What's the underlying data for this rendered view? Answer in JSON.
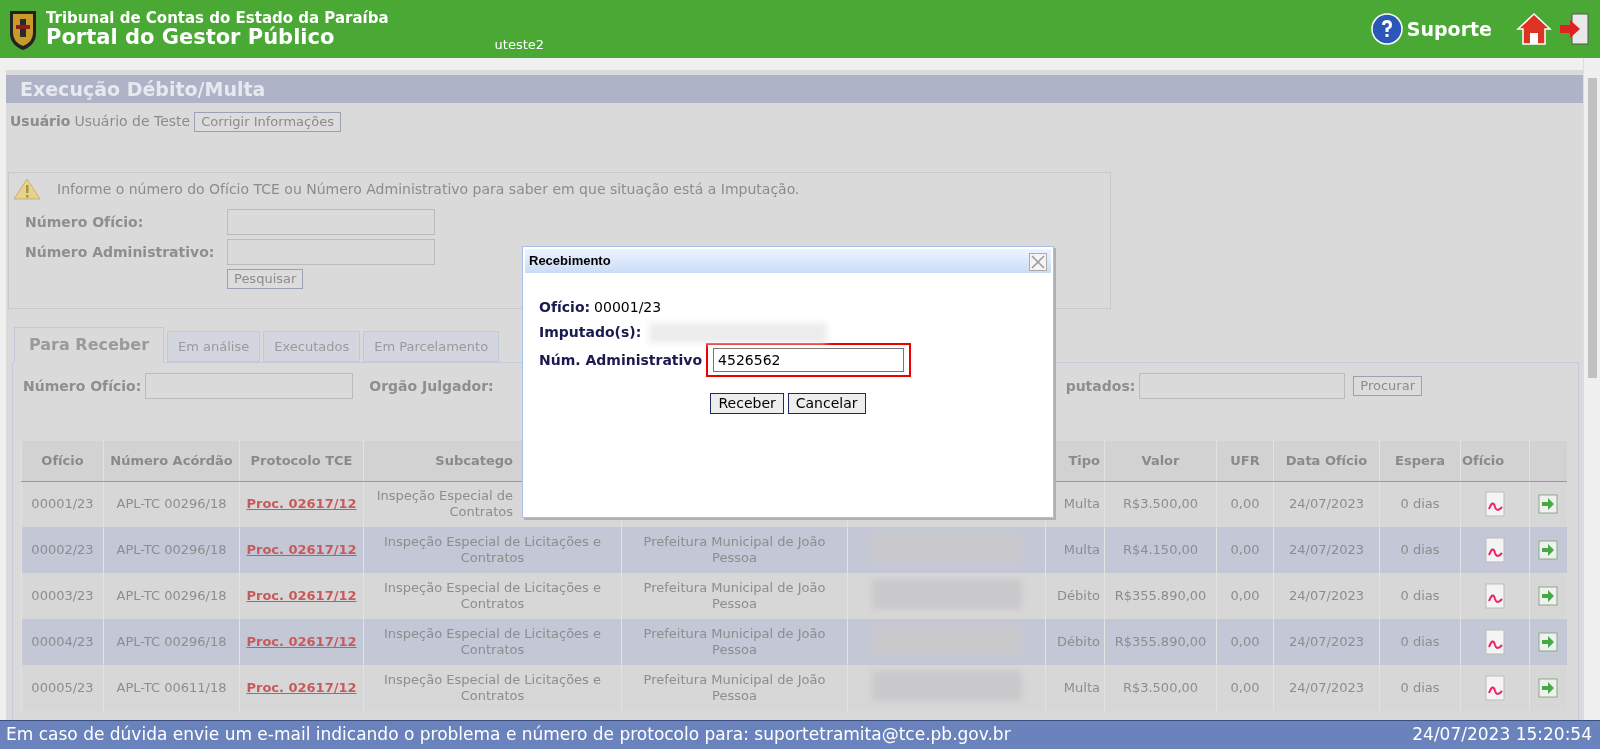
{
  "header": {
    "org": "Tribunal de Contas do Estado da Paraíba",
    "portal": "Portal do Gestor Público",
    "user": "uteste2",
    "support": "Suporte"
  },
  "page": {
    "title": "Execução Débito/Multa",
    "user_label": "Usuário",
    "user_name": "Usuário de Teste",
    "edit_button": "Corrigir Informações"
  },
  "search": {
    "notice": "Informe o número do Ofício TCE ou Número Administrativo para saber em que situação está a Imputação.",
    "fields": [
      {
        "label": "Número Ofício:"
      },
      {
        "label": "Número Administrativo:"
      }
    ],
    "button": "Pesquisar"
  },
  "tabs": [
    {
      "label": "Para Receber",
      "selected": true
    },
    {
      "label": "Em análise",
      "selected": false
    },
    {
      "label": "Executados",
      "selected": false
    },
    {
      "label": "Em Parcelamento",
      "selected": false
    }
  ],
  "filters": {
    "left": [
      {
        "label": "Número Ofício:",
        "kind": "input"
      },
      {
        "label": "Orgão Julgador:",
        "kind": "label"
      }
    ],
    "right": {
      "label": "putados:"
    },
    "button": "Procurar"
  },
  "table": {
    "columns": [
      {
        "label": "Ofício"
      },
      {
        "label": "Número Acórdão"
      },
      {
        "label": "Protocolo TCE"
      },
      {
        "label": "Subcatego"
      },
      {},
      {},
      {
        "label": "Tipo"
      },
      {
        "label": "Valor"
      },
      {
        "label": "UFR"
      },
      {
        "label": "Data Ofício"
      },
      {
        "label": "Espera"
      },
      {
        "label": "Ofício"
      },
      {}
    ],
    "rows": [
      {
        "oficio": "00001/23",
        "acordao": "APL-TC 00296/18",
        "protocolo": "Proc. 02617/12",
        "subcategoria": [
          "Inspeção Especial de",
          "Contratos"
        ],
        "tipo": "Multa",
        "valor": "R$3.500,00",
        "ufr": "0,00",
        "data": "24/07/2023",
        "espera": "0 dias"
      },
      {
        "oficio": "00002/23",
        "acordao": "APL-TC 00296/18",
        "protocolo": "Proc. 02617/12",
        "subcategoria": "Inspeção Especial de Licitações e Contratos",
        "orgao": "Prefeitura Municipal de João Pessoa",
        "tipo": "Multa",
        "valor": "R$4.150,00",
        "ufr": "0,00",
        "data": "24/07/2023",
        "espera": "0 dias"
      },
      {
        "oficio": "00003/23",
        "acordao": "APL-TC 00296/18",
        "protocolo": "Proc. 02617/12",
        "subcategoria": "Inspeção Especial de Licitações e Contratos",
        "orgao": "Prefeitura Municipal de João Pessoa",
        "tipo": "Débito",
        "valor": "R$355.890,00",
        "ufr": "0,00",
        "data": "24/07/2023",
        "espera": "0 dias"
      },
      {
        "oficio": "00004/23",
        "acordao": "APL-TC 00296/18",
        "protocolo": "Proc. 02617/12",
        "subcategoria": "Inspeção Especial de Licitações e Contratos",
        "orgao": "Prefeitura Municipal de João Pessoa",
        "tipo": "Débito",
        "valor": "R$355.890,00",
        "ufr": "0,00",
        "data": "24/07/2023",
        "espera": "0 dias"
      },
      {
        "oficio": "00005/23",
        "acordao": "APL-TC 00611/18",
        "protocolo": "Proc. 02617/12",
        "subcategoria": "Inspeção Especial de Licitações e Contratos",
        "orgao": "Prefeitura Municipal de João Pessoa",
        "tipo": "Multa",
        "valor": "R$3.500,00",
        "ufr": "0,00",
        "data": "24/07/2023",
        "espera": "0 dias"
      }
    ]
  },
  "dialog": {
    "title": "Recebimento",
    "oficio_label": "Ofício:",
    "oficio": "00001/23",
    "imputados_label": "Imputado(s):",
    "admin_label": "Núm. Administrativo",
    "admin_value": "4526562",
    "admin_highlighted": true,
    "buttons": [
      "Receber",
      "Cancelar"
    ]
  },
  "footer": {
    "message": "Em caso de dúvida envie um e-mail indicando o problema e número de protocolo para: suportetramita@tce.pb.gov.br",
    "datetime": "24/07/2023 15:20:54"
  }
}
